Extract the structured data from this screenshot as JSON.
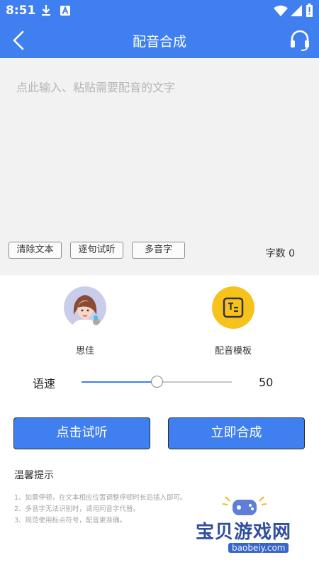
{
  "status_bar": {
    "time": "8:51"
  },
  "app_bar": {
    "title": "配音合成"
  },
  "editor": {
    "placeholder": "点此输入、粘贴需要配音的文字",
    "clear_label": "清除文本",
    "sentence_preview_label": "逐句试听",
    "polyphone_label": "多音字",
    "word_count": "字数 0"
  },
  "voices": [
    {
      "label": "思佳",
      "icon": "avatar"
    },
    {
      "label": "配音模板",
      "icon": "template-icon"
    }
  ],
  "speed": {
    "label": "语速",
    "value": "50",
    "level": 50,
    "max": 100
  },
  "actions": {
    "preview_label": "点击试听",
    "synthesize_label": "立即合成"
  },
  "tips": {
    "title": "温馨提示",
    "items": [
      "1、如需停顿，在文本相应位置调整停顿时长后插入即可。",
      "2、多音字无法识别时，请用同音字代替。",
      "3、规范使用标点符号，配音更准确。"
    ]
  },
  "watermark": {
    "text": "宝贝游戏网",
    "url": "baobeiy.com"
  },
  "colors": {
    "primary": "#3f7ff0",
    "accent_yellow": "#f7c21b"
  }
}
